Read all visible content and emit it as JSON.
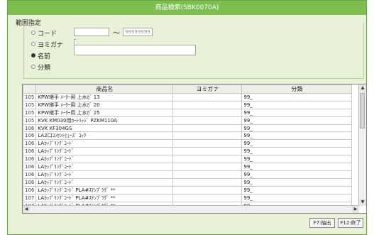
{
  "window": {
    "title": "商品検索(SBK0070A)"
  },
  "filter": {
    "group_label": "範囲指定",
    "options": [
      {
        "label": "コード",
        "selected": false
      },
      {
        "label": "ヨミガナ",
        "selected": false
      },
      {
        "label": "名前",
        "selected": true
      },
      {
        "label": "分類",
        "selected": false
      }
    ],
    "code_from_value": "",
    "range_sep": "～",
    "code_to_placeholder": "99999999",
    "yomigana_value": "",
    "name_value": ""
  },
  "table": {
    "headers": [
      "",
      "商品名",
      "ヨミガナ",
      "分類"
    ],
    "rows": [
      [
        "105",
        "KPW継手 ﾒｰﾀｰ用 上水ｶﾞ 13",
        "",
        "99_"
      ],
      [
        "105",
        "KPW継手 ﾒｰﾀｰ用 上水ｶﾞ 20",
        "",
        "99_"
      ],
      [
        "105",
        "KPW継手 ﾒｰﾀｰ用 上水ｶﾞ 25",
        "",
        "99_"
      ],
      [
        "105",
        "KVK KM030用ｶｰﾄﾘｯｼﾞ PZKM110A",
        "",
        "99_"
      ],
      [
        "106",
        "KVK KF304GS",
        "",
        "99_"
      ],
      [
        "106",
        "LA2口ｺﾝｾﾝﾄﾋｭｰｽﾞ ｺｯｸ",
        "",
        "99_"
      ],
      [
        "106",
        "LAｶｯﾌﾟﾘﾝｸﾞｺｰﾄﾞ",
        "",
        "99_"
      ],
      [
        "106",
        "LAｶｯﾌﾟﾘﾝｸﾞｺｰﾄﾞ",
        "",
        "99_"
      ],
      [
        "106",
        "LAｶｯﾌﾟﾘﾝｸﾞｺｰﾄﾞ",
        "",
        "99_"
      ],
      [
        "106",
        "LAｶｯﾌﾟﾘﾝｸﾞｺｰﾄﾞ",
        "",
        "99_"
      ],
      [
        "106",
        "LAｶｯﾌﾟﾘﾝｸﾞｺｰﾄﾞ",
        "",
        "99_"
      ],
      [
        "106",
        "LAｶｯﾌﾟﾘﾝｸﾞｺｰﾄﾞ",
        "",
        "99_"
      ],
      [
        "106",
        "LAｶｯﾌﾟﾘﾝｸﾞｺｰﾄﾞ PLA#ｽﾃﾝﾌﾞﾗｸﾞ **",
        "",
        "99_"
      ],
      [
        "107",
        "LAｶｯﾌﾟﾘﾝｸﾞｺｰﾄﾞ PLA#ｽﾃﾝﾌﾞﾗｸﾞ **",
        "",
        "99_"
      ],
      [
        "107",
        "LAｶｯﾌﾟﾘﾝｸﾞｺｰﾄﾞ PLA#ｽﾃﾝﾌﾞﾗｸﾞ **",
        "",
        "99_"
      ],
      [
        "107",
        "LAｶｯﾌﾟﾘﾝｸﾞｺｰﾄﾞ",
        "",
        "99_"
      ],
      [
        "107",
        "LAｶｯﾌﾟﾘﾝｸﾞｺｰﾄﾞ",
        "",
        "99_"
      ]
    ]
  },
  "scroll": {
    "up_icon": "▲",
    "down_icon": "▼",
    "left_icon": "◀",
    "right_icon": "▶"
  },
  "buttons": {
    "output": "F7:抽出",
    "close": "F12:終了"
  }
}
